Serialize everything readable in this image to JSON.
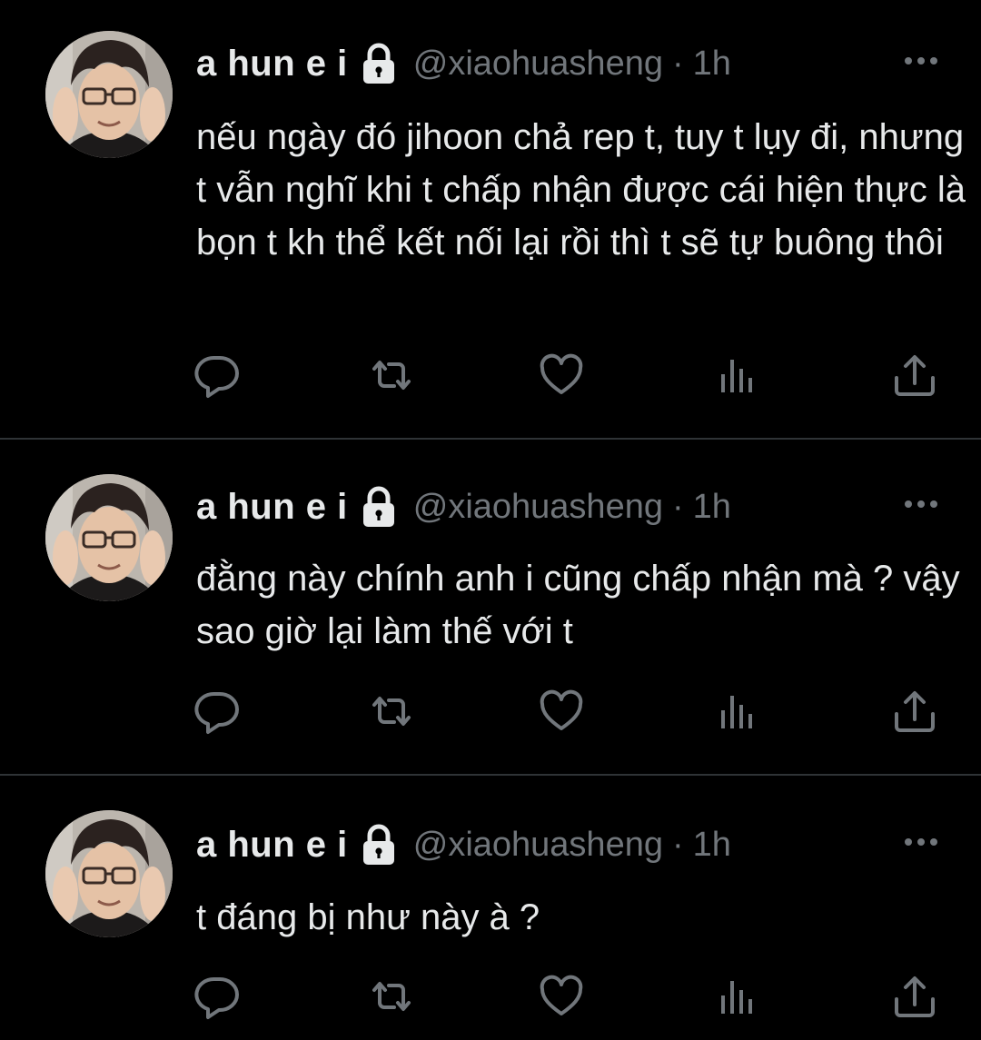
{
  "tweets": [
    {
      "author": {
        "display_name": "a hun e i",
        "handle": "@xiaohuasheng",
        "protected_icon": "lock-icon",
        "avatar": "avatar"
      },
      "separator": "·",
      "time": "1h",
      "text": "nếu ngày đó jihoon chả rep t, tuy t lụy đi, nhưng t vẫn nghĩ khi t chấp nhận được cái hiện thực là bọn t kh thể kết nối lại rồi thì t sẽ tự buông thôi",
      "actions": [
        "reply-icon",
        "retweet-icon",
        "like-icon",
        "views-icon",
        "share-icon"
      ]
    },
    {
      "author": {
        "display_name": "a hun e i",
        "handle": "@xiaohuasheng",
        "protected_icon": "lock-icon",
        "avatar": "avatar"
      },
      "separator": "·",
      "time": "1h",
      "text": "đằng này chính anh i cũng chấp nhận mà ? vậy sao giờ lại làm thế với t",
      "actions": [
        "reply-icon",
        "retweet-icon",
        "like-icon",
        "views-icon",
        "share-icon"
      ]
    },
    {
      "author": {
        "display_name": "a hun e i",
        "handle": "@xiaohuasheng",
        "protected_icon": "lock-icon",
        "avatar": "avatar"
      },
      "separator": "·",
      "time": "1h",
      "text": "t đáng bị như này à ?",
      "actions": [
        "reply-icon",
        "retweet-icon",
        "like-icon",
        "views-icon",
        "share-icon"
      ]
    }
  ],
  "colors": {
    "background": "#000000",
    "primary_text": "#e7e9ea",
    "secondary_text": "#71767b",
    "divider": "#2f3336"
  }
}
